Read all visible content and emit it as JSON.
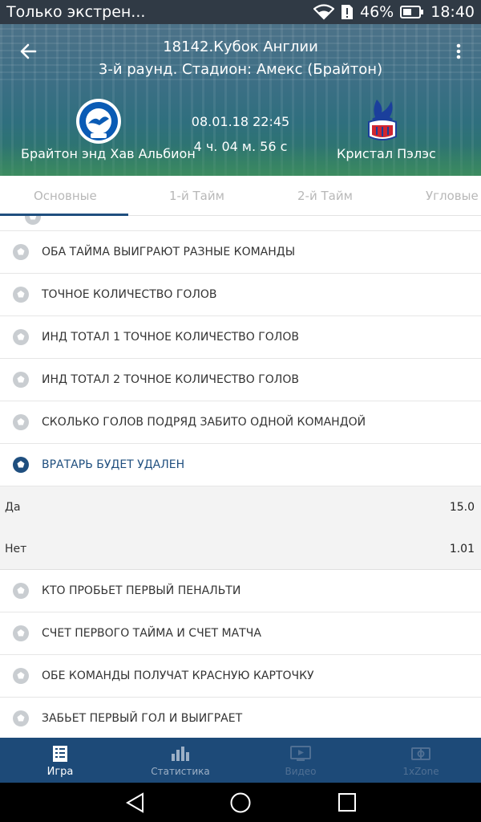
{
  "status_bar": {
    "notification": "Только экстрен...",
    "battery": "46%",
    "time": "18:40"
  },
  "header": {
    "title": "18142.Кубок Англии",
    "subtitle": "3-й раунд. Стадион: Амекс (Брайтон)",
    "home_team": "Брайтон энд Хав Альбион",
    "away_team": "Кристал Пэлэс",
    "date": "08.01.18 22:45",
    "countdown": "4 ч. 04 м. 56 с"
  },
  "tabs": [
    {
      "label": "Основные",
      "active": true
    },
    {
      "label": "1-й Тайм",
      "active": false
    },
    {
      "label": "2-й Тайм",
      "active": false
    },
    {
      "label": "Угловые",
      "active": false
    }
  ],
  "markets": [
    {
      "label": "ОБА ТАЙМА ВЫИГРАЮТ РАЗНЫЕ КОМАНДЫ"
    },
    {
      "label": "ТОЧНОЕ КОЛИЧЕСТВО ГОЛОВ"
    },
    {
      "label": "ИНД ТОТАЛ 1 ТОЧНОЕ КОЛИЧЕСТВО ГОЛОВ"
    },
    {
      "label": "ИНД ТОТАЛ 2 ТОЧНОЕ КОЛИЧЕСТВО ГОЛОВ"
    },
    {
      "label": "СКОЛЬКО ГОЛОВ ПОДРЯД ЗАБИТО ОДНОЙ КОМАНДОЙ"
    },
    {
      "label": "ВРАТАРЬ БУДЕТ УДАЛЕН",
      "expanded": true
    },
    {
      "label": "КТО ПРОБЬЕТ ПЕРВЫЙ ПЕНАЛЬТИ"
    },
    {
      "label": "СЧЕТ ПЕРВОГО ТАЙМА И СЧЕТ МАТЧА"
    },
    {
      "label": "ОБЕ КОМАНДЫ ПОЛУЧАТ КРАСНУЮ КАРТОЧКУ"
    },
    {
      "label": "ЗАБЬЕТ ПЕРВЫЙ ГОЛ И ВЫИГРАЕТ"
    }
  ],
  "expanded_outcomes": [
    {
      "label": "Да",
      "odds": "15.0"
    },
    {
      "label": "Нет",
      "odds": "1.01"
    }
  ],
  "bottom_nav": [
    {
      "label": "Игра",
      "icon": "document-icon",
      "state": "active"
    },
    {
      "label": "Статистика",
      "icon": "bar-chart-icon",
      "state": "dim"
    },
    {
      "label": "Видео",
      "icon": "video-icon",
      "state": "faded"
    },
    {
      "label": "1xZone",
      "icon": "zone-icon",
      "state": "faded"
    }
  ],
  "colors": {
    "accent": "#1f4f7f",
    "bottom_nav_bg": "#1d4a78",
    "status_bar_bg": "#303a45"
  }
}
